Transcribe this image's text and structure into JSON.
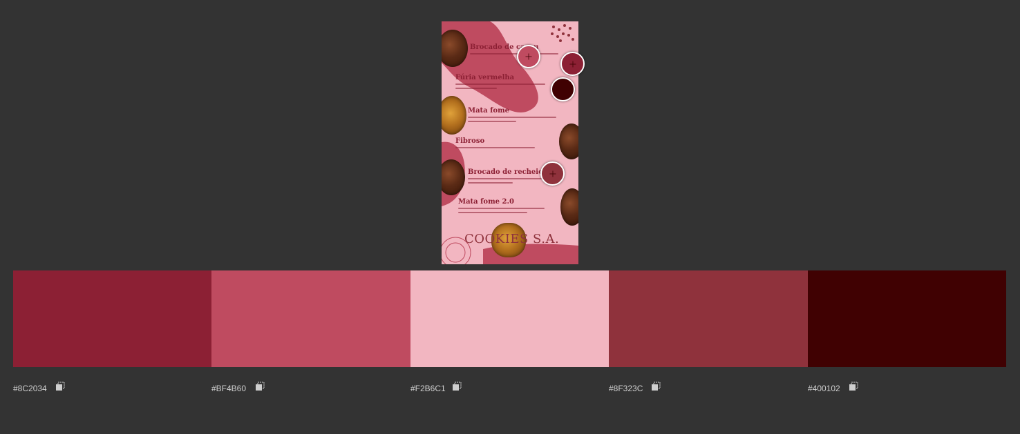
{
  "preview": {
    "menu_items": [
      {
        "name": "Brocado de cacau"
      },
      {
        "name": "Fúria vermelha"
      },
      {
        "name": "Mata fome"
      },
      {
        "name": "Fibroso"
      },
      {
        "name": "Brocado de recheio"
      },
      {
        "name": "Mata fome 2.0"
      }
    ],
    "brand": "COOKIES S.A."
  },
  "palette": [
    {
      "hex": "#8C2034",
      "color": "#8C2034"
    },
    {
      "hex": "#BF4B60",
      "color": "#BF4B60"
    },
    {
      "hex": "#F2B6C1",
      "color": "#F2B6C1"
    },
    {
      "hex": "#8F323C",
      "color": "#8F323C"
    },
    {
      "hex": "#400102",
      "color": "#400102"
    }
  ],
  "icons": {
    "copy": "copy-icon"
  }
}
